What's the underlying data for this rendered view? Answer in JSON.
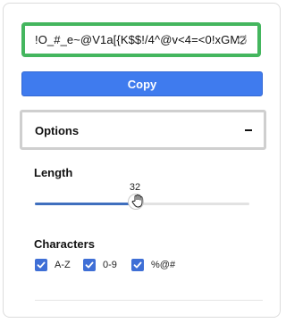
{
  "password": {
    "value": "!O_#_e~@V1a[{K$$!/4^@v<4=<0!xGM2",
    "refresh_icon": "refresh-icon"
  },
  "copy_button": {
    "label": "Copy",
    "color": "#3f7bee"
  },
  "options": {
    "title": "Options",
    "toggle_icon": "minus-icon"
  },
  "length": {
    "label": "Length",
    "value": "32",
    "fraction": 0.47
  },
  "characters": {
    "label": "Characters",
    "items": [
      {
        "label": "A-Z",
        "checked": true
      },
      {
        "label": "0-9",
        "checked": true
      },
      {
        "label": "%@#",
        "checked": true
      }
    ]
  },
  "colors": {
    "accent": "#3f6fd6",
    "success_border": "#44b65e"
  }
}
